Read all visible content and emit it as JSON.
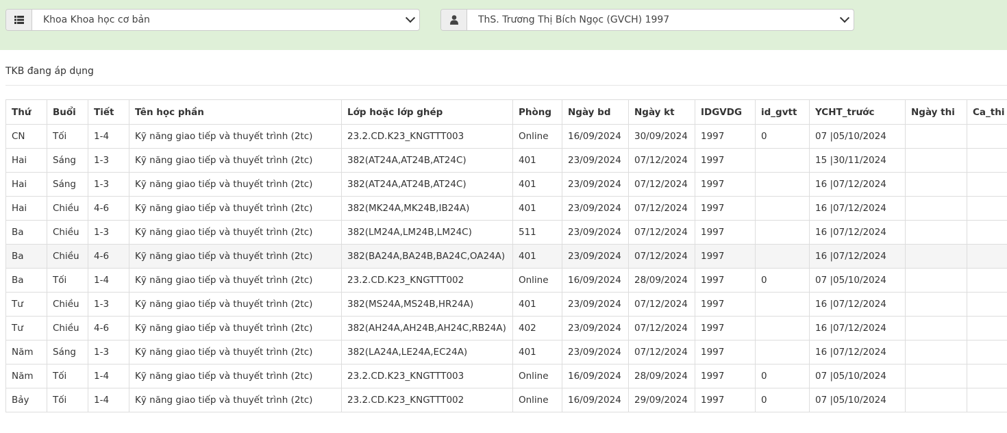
{
  "filters": {
    "faculty": "Khoa Khoa học cơ bản",
    "teacher": "ThS. Trương Thị Bích Ngọc (GVCH) 1997"
  },
  "title": "TKB đang áp dụng",
  "columns": [
    "Thứ",
    "Buổi",
    "Tiết",
    "Tên học phần",
    "Lớp hoặc lớp ghép",
    "Phòng",
    "Ngày bd",
    "Ngày kt",
    "IDGVDG",
    "id_gvtt",
    "YCHT_trước",
    "Ngày thi",
    "Ca_thi"
  ],
  "rows": [
    [
      "CN",
      "Tối",
      "1-4",
      "Kỹ năng giao tiếp và thuyết trình (2tc)",
      "23.2.CD.K23_KNGTTT003",
      "Online",
      "16/09/2024",
      "30/09/2024",
      "1997",
      "0",
      "07 |05/10/2024",
      "",
      ""
    ],
    [
      "Hai",
      "Sáng",
      "1-3",
      "Kỹ năng giao tiếp và thuyết trình (2tc)",
      "382(AT24A,AT24B,AT24C)",
      "401",
      "23/09/2024",
      "07/12/2024",
      "1997",
      "",
      "15 |30/11/2024",
      "",
      ""
    ],
    [
      "Hai",
      "Sáng",
      "1-3",
      "Kỹ năng giao tiếp và thuyết trình (2tc)",
      "382(AT24A,AT24B,AT24C)",
      "401",
      "23/09/2024",
      "07/12/2024",
      "1997",
      "",
      "16 |07/12/2024",
      "",
      ""
    ],
    [
      "Hai",
      "Chiều",
      "4-6",
      "Kỹ năng giao tiếp và thuyết trình (2tc)",
      "382(MK24A,MK24B,IB24A)",
      "401",
      "23/09/2024",
      "07/12/2024",
      "1997",
      "",
      "16 |07/12/2024",
      "",
      ""
    ],
    [
      "Ba",
      "Chiều",
      "1-3",
      "Kỹ năng giao tiếp và thuyết trình (2tc)",
      "382(LM24A,LM24B,LM24C)",
      "511",
      "23/09/2024",
      "07/12/2024",
      "1997",
      "",
      "16 |07/12/2024",
      "",
      ""
    ],
    [
      "Ba",
      "Chiều",
      "4-6",
      "Kỹ năng giao tiếp và thuyết trình (2tc)",
      "382(BA24A,BA24B,BA24C,OA24A)",
      "401",
      "23/09/2024",
      "07/12/2024",
      "1997",
      "",
      "16 |07/12/2024",
      "",
      ""
    ],
    [
      "Ba",
      "Tối",
      "1-4",
      "Kỹ năng giao tiếp và thuyết trình (2tc)",
      "23.2.CD.K23_KNGTTT002",
      "Online",
      "16/09/2024",
      "28/09/2024",
      "1997",
      "0",
      "07 |05/10/2024",
      "",
      ""
    ],
    [
      "Tư",
      "Chiều",
      "1-3",
      "Kỹ năng giao tiếp và thuyết trình (2tc)",
      "382(MS24A,MS24B,HR24A)",
      "401",
      "23/09/2024",
      "07/12/2024",
      "1997",
      "",
      "16 |07/12/2024",
      "",
      ""
    ],
    [
      "Tư",
      "Chiều",
      "4-6",
      "Kỹ năng giao tiếp và thuyết trình (2tc)",
      "382(AH24A,AH24B,AH24C,RB24A)",
      "402",
      "23/09/2024",
      "07/12/2024",
      "1997",
      "",
      "16 |07/12/2024",
      "",
      ""
    ],
    [
      "Năm",
      "Sáng",
      "1-3",
      "Kỹ năng giao tiếp và thuyết trình (2tc)",
      "382(LA24A,LE24A,EC24A)",
      "401",
      "23/09/2024",
      "07/12/2024",
      "1997",
      "",
      "16 |07/12/2024",
      "",
      ""
    ],
    [
      "Năm",
      "Tối",
      "1-4",
      "Kỹ năng giao tiếp và thuyết trình (2tc)",
      "23.2.CD.K23_KNGTTT003",
      "Online",
      "16/09/2024",
      "28/09/2024",
      "1997",
      "0",
      "07 |05/10/2024",
      "",
      ""
    ],
    [
      "Bảy",
      "Tối",
      "1-4",
      "Kỹ năng giao tiếp và thuyết trình (2tc)",
      "23.2.CD.K23_KNGTTT002",
      "Online",
      "16/09/2024",
      "29/09/2024",
      "1997",
      "0",
      "07 |05/10/2024",
      "",
      ""
    ]
  ],
  "icons": {
    "faculty": "list-icon",
    "teacher": "user-icon"
  },
  "colors": {
    "topbar": "#dff0d8"
  }
}
